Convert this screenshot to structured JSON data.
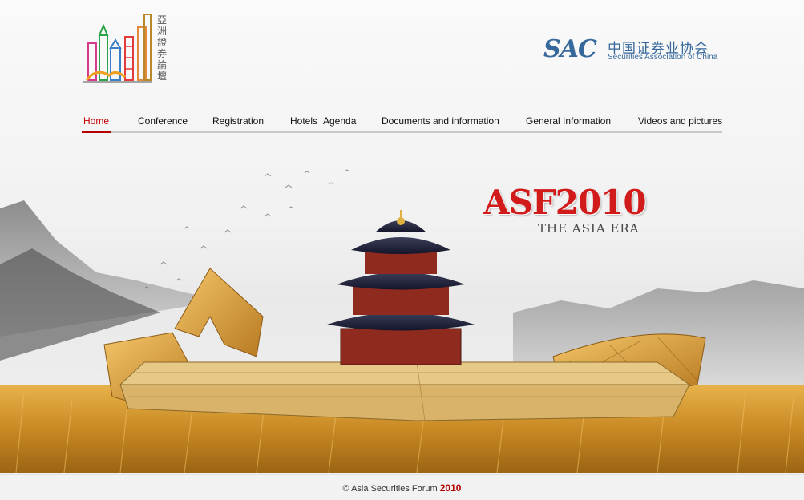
{
  "header": {
    "logo_chars": [
      "亞",
      "洲",
      "證",
      "券",
      "論",
      "壇"
    ],
    "sac_mark": "SAC",
    "sac_name_cn": "中国证券业协会",
    "sac_name_en": "Securities Association of China"
  },
  "nav": {
    "items": [
      {
        "label": "Home",
        "active": true
      },
      {
        "label": "Conference"
      },
      {
        "label": "Registration"
      },
      {
        "label": "Hotels"
      },
      {
        "label": "Agenda"
      },
      {
        "label": "Documents and information"
      },
      {
        "label": "General Information"
      },
      {
        "label": "Videos and pictures"
      }
    ]
  },
  "hero": {
    "title": "ASF2010",
    "subtitle": "THE ASIA ERA"
  },
  "footer": {
    "copyright_prefix": "© Asia Securities Forum",
    "year": "2010"
  },
  "colors": {
    "accent_red": "#c00000",
    "brand_blue": "#36689b",
    "wheat_gold": "#d39a2c"
  }
}
